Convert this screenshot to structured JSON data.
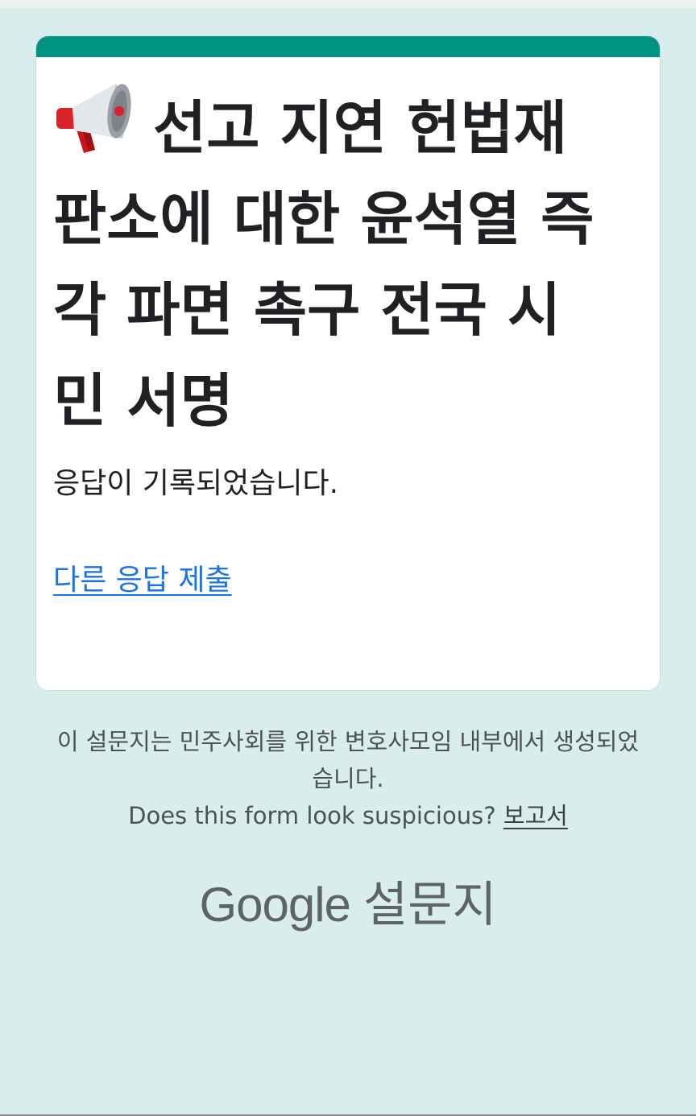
{
  "form": {
    "title": "선고 지연 헌법재판소에 대한 윤석열 즉각 파면 촉구 전국 시민 서명",
    "title_icon": "megaphone-icon",
    "confirmation_message": "응답이 기록되었습니다.",
    "submit_another_label": "다른 응답 제출",
    "accent_color": "#009485"
  },
  "footer": {
    "created_by": "이 설문지는 민주사회를 위한 변호사모임 내부에서 생성되었습니다.",
    "suspicious_question": "Does this form look suspicious?",
    "report_label": "보고서"
  },
  "branding": {
    "google": "Google",
    "product": "설문지"
  }
}
